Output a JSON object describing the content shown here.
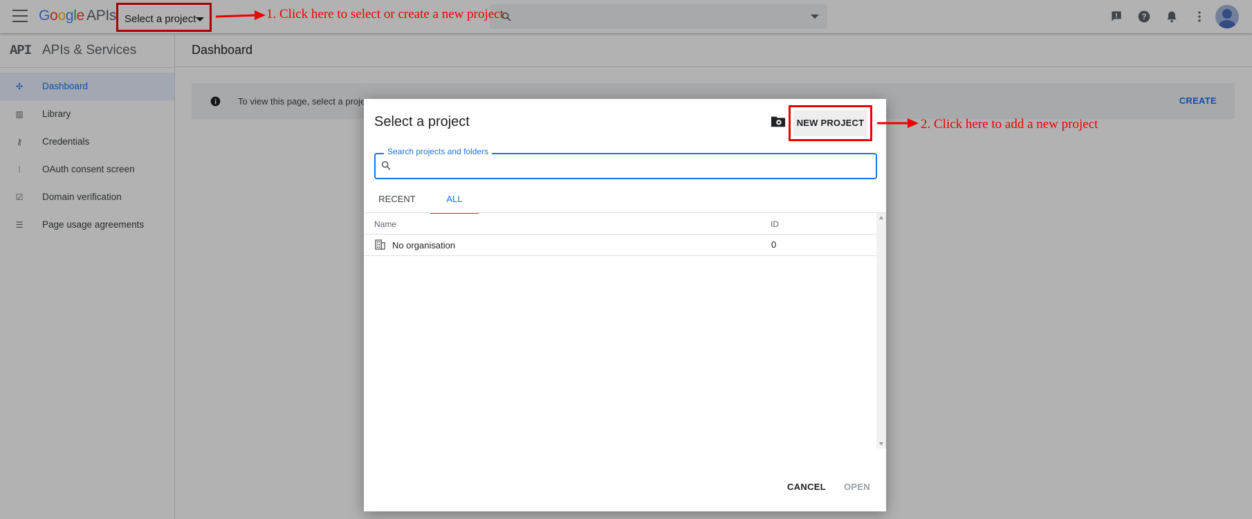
{
  "topbar": {
    "logo": {
      "g": "G",
      "o1": "o",
      "o2": "o",
      "g2": "g",
      "l": "l",
      "e": "e",
      "apis": "APIs"
    },
    "project_selector_label": "Select a project",
    "search_placeholder": "",
    "icons": [
      "menu-icon",
      "search-icon",
      "feedback-icon",
      "help-icon",
      "notifications-icon",
      "more-vert-icon",
      "avatar"
    ]
  },
  "annotations": {
    "step1": "1. Click here to select or create a new project",
    "step2": "2. Click here to add a new project",
    "color": "#ee0000"
  },
  "sidebar": {
    "logo_text": "API",
    "title": "APIs & Services",
    "items": [
      {
        "label": "Dashboard",
        "icon": "dashboard-icon",
        "active": true
      },
      {
        "label": "Library",
        "icon": "library-icon",
        "active": false
      },
      {
        "label": "Credentials",
        "icon": "key-icon",
        "active": false
      },
      {
        "label": "OAuth consent screen",
        "icon": "oauth-icon",
        "active": false
      },
      {
        "label": "Domain verification",
        "icon": "checkbox-icon",
        "active": false
      },
      {
        "label": "Page usage agreements",
        "icon": "settings-list-icon",
        "active": false
      }
    ]
  },
  "main": {
    "title": "Dashboard",
    "info_text": "To view this page, select a proje",
    "create_label": "CREATE"
  },
  "dialog": {
    "title": "Select a project",
    "new_project_label": "NEW PROJECT",
    "search_label": "Search projects and folders",
    "search_value": "",
    "tabs": [
      "RECENT",
      "ALL"
    ],
    "active_tab": "ALL",
    "columns": [
      "Name",
      "ID"
    ],
    "rows": [
      {
        "name": "No organisation",
        "id": "0",
        "icon": "building-icon"
      }
    ],
    "cancel_label": "CANCEL",
    "open_label": "OPEN"
  },
  "colors": {
    "accent": "#1a73e8",
    "annotation": "#ee0000"
  }
}
